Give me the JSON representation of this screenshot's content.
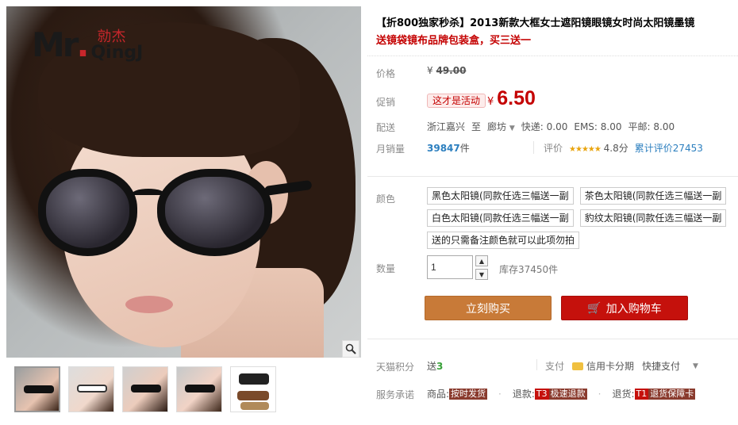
{
  "brand": {
    "mr": "Mr",
    "dot": ".",
    "cn": "勍杰",
    "en": "QingJ"
  },
  "product": {
    "title": "【折800独家秒杀】2013新款大框女士遮阳镜眼镜女时尚太阳镜墨镜",
    "subtitle": "送镜袋镜布品牌包装盒，买三送一"
  },
  "price": {
    "label": "价格",
    "currency": "¥",
    "value": "49.00"
  },
  "promo": {
    "label": "促销",
    "tag": "这才是活动",
    "currency": "¥",
    "value": "6.50"
  },
  "shipping": {
    "label": "配送",
    "from": "浙江嘉兴",
    "to_word": "至",
    "to": "廊坊",
    "express": "快递: 0.00",
    "ems": "EMS: 8.00",
    "mail": "平邮: 8.00"
  },
  "sales": {
    "label": "月销量",
    "count": "39847",
    "unit": "件",
    "rating_label": "评价",
    "stars": "★★★★★",
    "score": "4.8分",
    "reviews": "累计评价27453"
  },
  "colors": {
    "label": "颜色",
    "options": [
      "黑色太阳镜(同款任选三幅送一副",
      "茶色太阳镜(同款任选三幅送一副",
      "白色太阳镜(同款任选三幅送一副",
      "豹纹太阳镜(同款任选三幅送一副",
      "送的只需备注颜色就可以此项勿拍"
    ]
  },
  "quantity": {
    "label": "数量",
    "value": "1",
    "up": "▲",
    "down": "▼",
    "stock": "库存37450件"
  },
  "buttons": {
    "buy": "立刻购买",
    "cart": "加入购物车",
    "cart_icon": "🛒"
  },
  "points": {
    "label": "天猫积分",
    "text": "送",
    "value": "3"
  },
  "payment": {
    "label": "支付",
    "credit": "信用卡分期",
    "quick": "快捷支付",
    "arrow": "▼"
  },
  "service": {
    "label": "服务承诺",
    "items": [
      {
        "prefix": "商品:",
        "badge1": "",
        "badge2": "按时发货"
      },
      {
        "prefix": "退款:",
        "badge1": "T3",
        "badge2": "极速退款"
      },
      {
        "prefix": "退货:",
        "badge1": "T1",
        "badge2": "退货保障卡"
      }
    ]
  },
  "icons": {
    "zoom": "zoom-icon",
    "card": "credit-card-icon",
    "cart": "cart-icon"
  }
}
